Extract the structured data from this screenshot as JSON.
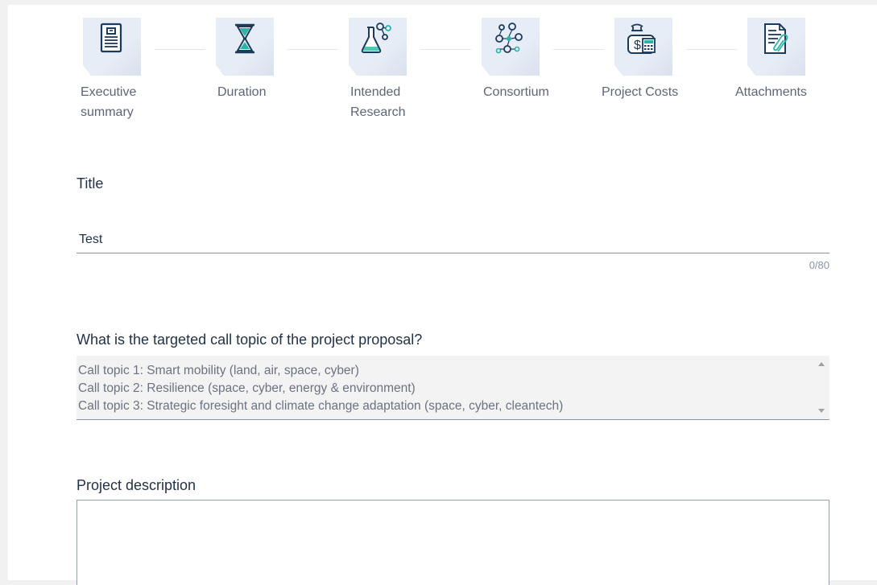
{
  "steps": [
    {
      "label": "Executive summary",
      "icon": "document-icon"
    },
    {
      "label": "Duration",
      "icon": "hourglass-icon"
    },
    {
      "label": "Intended Research",
      "icon": "flask-icon"
    },
    {
      "label": "Consortium",
      "icon": "network-people-icon"
    },
    {
      "label": "Project Costs",
      "icon": "money-calculator-icon"
    },
    {
      "label": "Attachments",
      "icon": "paperclip-document-icon"
    }
  ],
  "title_field": {
    "label": "Title",
    "value": "Test",
    "counter": "0/80"
  },
  "call_topic": {
    "label": "What is the targeted call topic of the project proposal?",
    "options": [
      "Call topic 1: Smart mobility (land, air, space, cyber)",
      "Call topic 2: Resilience (space, cyber, energy & environment)",
      "Call topic 3: Strategic foresight and climate change adaptation (space, cyber, cleantech)"
    ]
  },
  "description": {
    "label": "Project description",
    "value": ""
  },
  "colors": {
    "accent": "#1b3a5c",
    "teal": "#2ab3a6",
    "text": "#243247",
    "muted": "#5c6677"
  }
}
